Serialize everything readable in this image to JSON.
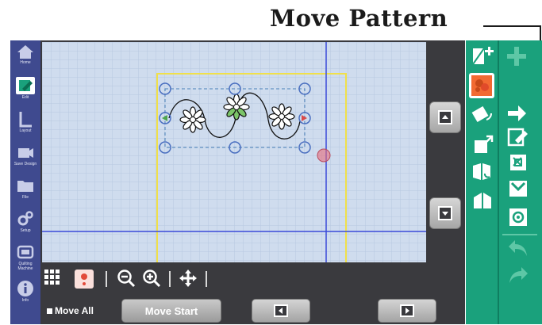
{
  "callout": {
    "title": "Move Pattern"
  },
  "sidebar": {
    "items": [
      {
        "label": "Home",
        "icon": "home-icon"
      },
      {
        "label": "Edit",
        "icon": "edit-icon"
      },
      {
        "label": "Layout",
        "icon": "layout-icon"
      },
      {
        "label": "Save Design",
        "icon": "camera-icon"
      },
      {
        "label": "File",
        "icon": "folder-icon"
      },
      {
        "label": "Setup",
        "icon": "gears-icon"
      },
      {
        "label": "Quilting Machine",
        "icon": "machine-icon"
      },
      {
        "label": "Info",
        "icon": "info-icon"
      }
    ]
  },
  "toolbar": {
    "icons": [
      "grid-icon",
      "pattern-thumbnail-icon",
      "zoom-out-icon",
      "zoom-in-icon",
      "pan-icon"
    ]
  },
  "bottom": {
    "move_all_label": "Move All",
    "move_start_label": "Move Start"
  },
  "right_panel": {
    "icons_col1": [
      "add-pattern-icon",
      "move-pattern-icon",
      "rotate-pattern-icon",
      "resize-pattern-icon",
      "flip-pattern-icon",
      "mirror-pattern-icon"
    ],
    "icons_col2": [
      "add-icon",
      "next-arrow-icon",
      "edit-pattern-icon",
      "crop-icon",
      "stitch-icon",
      "settings-icon",
      "undo-icon",
      "redo-icon"
    ]
  },
  "colors": {
    "sidebar": "#3f4a8f",
    "canvas": "#cfdcee",
    "right_panel": "#1aa17c",
    "boundary": "#f0e04a",
    "guide_lines": "#3a4ad8",
    "selected_handle": "#e66a7c"
  }
}
